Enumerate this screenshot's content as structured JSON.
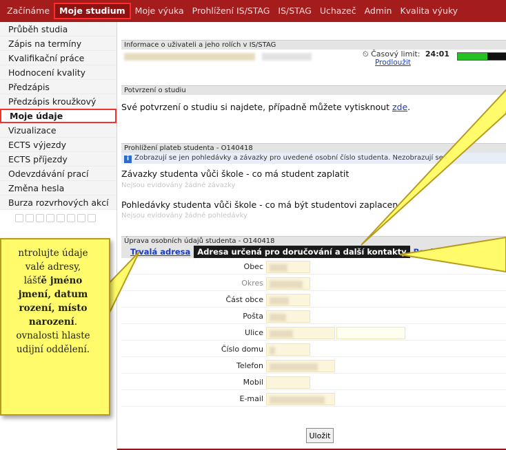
{
  "topnav": {
    "items": [
      "Začínáme",
      "Moje studium",
      "Moje výuka",
      "Prohlížení IS/STAG",
      "IS/STAG",
      "Uchazeč",
      "Admin",
      "Kvalita výuky"
    ]
  },
  "sidebar": {
    "items": [
      "Průběh studia",
      "Zápis na termíny",
      "Kvalifikační práce",
      "Hodnocení kvality",
      "Předzápis",
      "Předzápis kroužkový",
      "Moje údaje",
      "Vizualizace",
      "ECTS výjezdy",
      "ECTS příjezdy",
      "Odevzdávání prací",
      "Změna hesla",
      "Burza rozvrhových akcí"
    ]
  },
  "user_info": {
    "heading": "Informace o uživateli a jeho rolích v IS/STAG",
    "timer_label": "Časový limit:",
    "timer_value": "24:01",
    "extend_link": "Prodloužit",
    "progress": 0.55
  },
  "confirmation": {
    "heading": "Potvrzení o studiu",
    "text": "Své potvrzení o studiu si najdete, případně můžete vytisknout",
    "link": "zde",
    "suffix": "."
  },
  "payments": {
    "heading": "Prohlížení plateb studenta - O140418",
    "info": "Zobrazují se jen pohledávky a závazky pro uvedené osobní číslo studenta. Nezobrazují se",
    "obligations_title": "Závazky studenta vůči škole - co má student zaplatit",
    "obligations_empty": "Nejsou evidovány žádné závazky",
    "claims_title": "Pohledávky studenta vůči škole - co má být studentovi zaplaceno",
    "claims_empty": "Nejsou evidovány žádné pohledávky"
  },
  "personal": {
    "heading": "Úprava osobních údajů studenta - O140418",
    "tabs": [
      "Trvalá adresa",
      "Adresa určená pro doručování a další kontakty",
      "Bankovní účet"
    ],
    "fields": [
      "Obec",
      "Okres",
      "Část obce",
      "Pošta",
      "Ulice",
      "Číslo domu",
      "Telefon",
      "Mobil",
      "E-mail"
    ],
    "save_label": "Uložit"
  },
  "callout": {
    "line1": "ntrolujte údaje",
    "line2": "valé adresy,",
    "line3_plain": "lášť",
    "line3_bold": "ě jméno",
    "line4_bold": "jmení, datum",
    "line5_bold": "rození, místo",
    "line6_bold": "narození",
    "line6_tail": ".",
    "line7": "ovnalosti hlaste",
    "line8": "udijní oddělení."
  },
  "colors": {
    "nav_bg": "#a51c1c",
    "highlight_border": "#ff2b2b",
    "callout_bg": "#fffb6a",
    "link": "#1a3dbf",
    "progress": "#24c024"
  }
}
